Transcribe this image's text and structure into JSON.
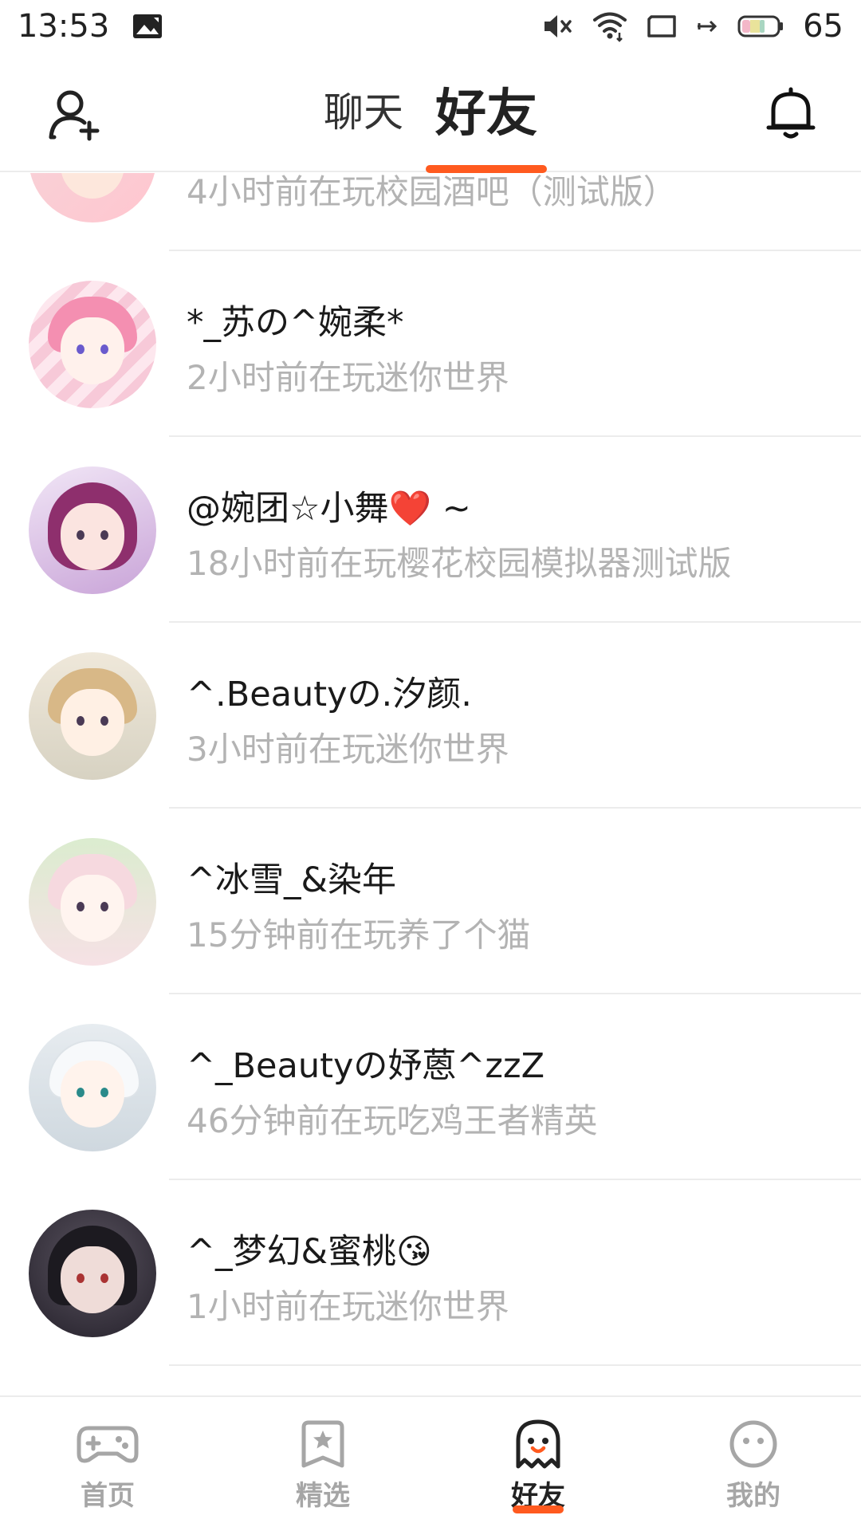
{
  "status_bar": {
    "time": "13:53",
    "battery": "65",
    "icons": [
      "image-notification-icon",
      "mute-icon",
      "wifi-icon",
      "screen-icon",
      "data-arrow-icon",
      "battery-icon"
    ]
  },
  "header": {
    "tabs": [
      {
        "label": "聊天",
        "active": false
      },
      {
        "label": "好友",
        "active": true
      }
    ],
    "left_icon": "add-friend-icon",
    "right_icon": "bell-icon"
  },
  "friends": [
    {
      "name": "",
      "status": "4小时前在玩校园酒吧（测试版）",
      "avatar_colors": [
        "#f6d4d9",
        "#ffc6cf"
      ]
    },
    {
      "name": "*_苏の^婉柔*",
      "status": "2小时前在玩迷你世界",
      "avatar_colors": [
        "#fbe3ea",
        "#f59ab8"
      ]
    },
    {
      "name": "@婉团☆小舞❤️ ~",
      "status": "18小时前在玩樱花校园模拟器测试版",
      "avatar_colors": [
        "#e9dbf1",
        "#a04a8c"
      ]
    },
    {
      "name": "^.Beautyの.汐颜.",
      "status": "3小时前在玩迷你世界",
      "avatar_colors": [
        "#efe8da",
        "#d8b887"
      ]
    },
    {
      "name": "^冰雪_&染年",
      "status": "15分钟前在玩养了个猫",
      "avatar_colors": [
        "#e6f1df",
        "#f6d9df"
      ]
    },
    {
      "name": "^_Beautyの妤蒽^zzZ",
      "status": "46分钟前在玩吃鸡王者精英",
      "avatar_colors": [
        "#e7ecf0",
        "#f4f6f8"
      ]
    },
    {
      "name": "^_梦幻&蜜桃😘",
      "status": "1小时前在玩迷你世界",
      "avatar_colors": [
        "#3a3640",
        "#2a2630"
      ]
    },
    {
      "name": "",
      "status": "",
      "avatar_colors": [
        "#f7dcdc",
        "#f2b6b6"
      ]
    }
  ],
  "bottom_nav": {
    "items": [
      {
        "label": "首页",
        "icon": "gamepad-icon",
        "active": false
      },
      {
        "label": "精选",
        "icon": "star-bookmark-icon",
        "active": false
      },
      {
        "label": "好友",
        "icon": "ghost-icon",
        "active": true
      },
      {
        "label": "我的",
        "icon": "smiley-icon",
        "active": false
      }
    ]
  },
  "colors": {
    "accent": "#ff5a1f",
    "secondary_text": "#b3b3b3",
    "inactive_nav": "#a6a6a6"
  }
}
